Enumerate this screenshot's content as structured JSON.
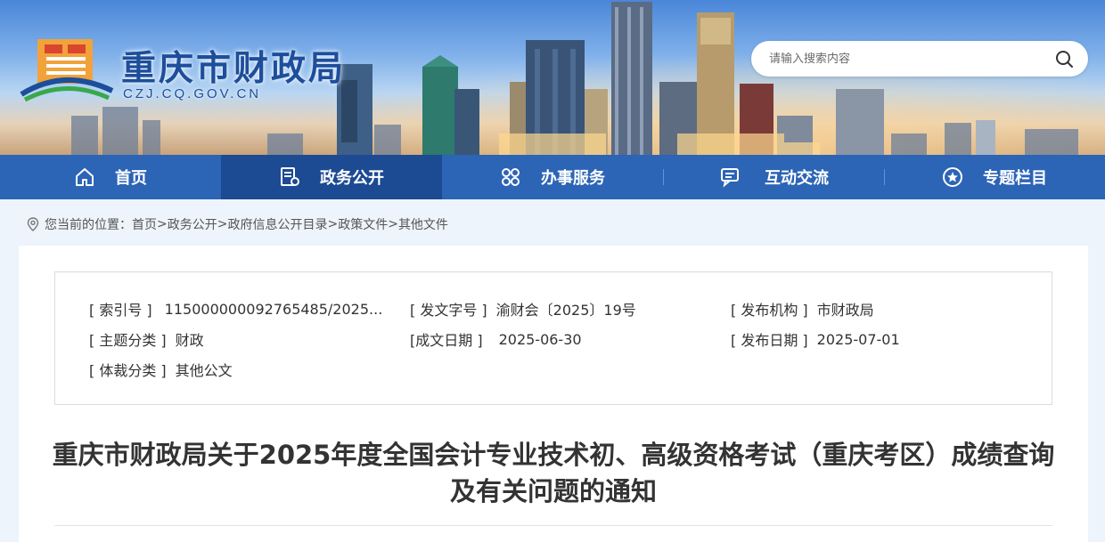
{
  "header": {
    "site_name": "重庆市财政局",
    "site_domain": "CZJ.CQ.GOV.CN",
    "search": {
      "placeholder": "请输入搜索内容"
    }
  },
  "nav": {
    "items": [
      {
        "label": "首页",
        "icon": "home-icon"
      },
      {
        "label": "政务公开",
        "icon": "document-icon",
        "active": true
      },
      {
        "label": "办事服务",
        "icon": "services-grid-icon"
      },
      {
        "label": "互动交流",
        "icon": "chat-icon"
      },
      {
        "label": "专题栏目",
        "icon": "star-badge-icon"
      }
    ]
  },
  "breadcrumb": {
    "prefix": "您当前的位置：",
    "items": [
      "首页",
      "政务公开",
      "政府信息公开目录",
      "政策文件",
      "其他文件"
    ],
    "separator": ">"
  },
  "meta": {
    "index_no": {
      "label": "[ 索引号 ]",
      "value": "115000000092765485/2025..."
    },
    "doc_no": {
      "label": "[ 发文字号 ]",
      "value": "渝财会〔2025〕19号"
    },
    "publisher": {
      "label": "[ 发布机构 ]",
      "value": "市财政局"
    },
    "topic": {
      "label": "[ 主题分类 ]",
      "value": "财政"
    },
    "created_date": {
      "label": "[成文日期 ]",
      "value": "2025-06-30"
    },
    "publish_date": {
      "label": "[ 发布日期 ]",
      "value": "2025-07-01"
    },
    "genre": {
      "label": "[ 体裁分类 ]",
      "value": "其他公文"
    }
  },
  "article": {
    "title": "重庆市财政局关于2025年度全国会计专业技术初、高级资格考试（重庆考区）成绩查询及有关问题的通知"
  },
  "colors": {
    "nav_bg": "#2c64b6",
    "nav_active": "#1c4a93",
    "brand_text": "#1d4e9b",
    "page_bg": "#eef4fb"
  }
}
